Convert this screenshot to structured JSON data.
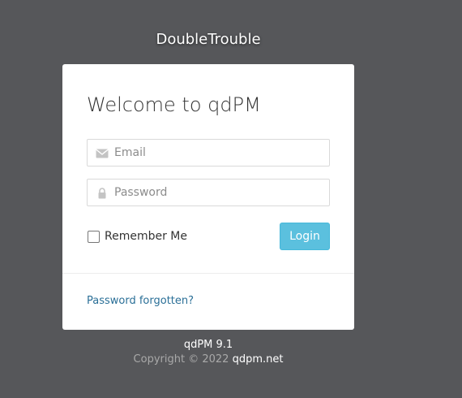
{
  "brand": {
    "name": "DoubleTrouble"
  },
  "login": {
    "title": "Welcome to qdPM",
    "email": {
      "placeholder": "Email",
      "value": "",
      "icon": "envelope-icon"
    },
    "password": {
      "placeholder": "Password",
      "value": "",
      "icon": "lock-icon"
    },
    "remember_label": "Remember Me",
    "remember_checked": false,
    "login_button": "Login",
    "forgot_link": "Password forgotten?"
  },
  "footer": {
    "version": "qdPM 9.1",
    "copyright_prefix": "Copyright © 2022",
    "site_link": "qdpm.net"
  },
  "colors": {
    "background": "#56575a",
    "card": "#ffffff",
    "login_button": "#5bc0de",
    "link": "#2a6f97"
  }
}
